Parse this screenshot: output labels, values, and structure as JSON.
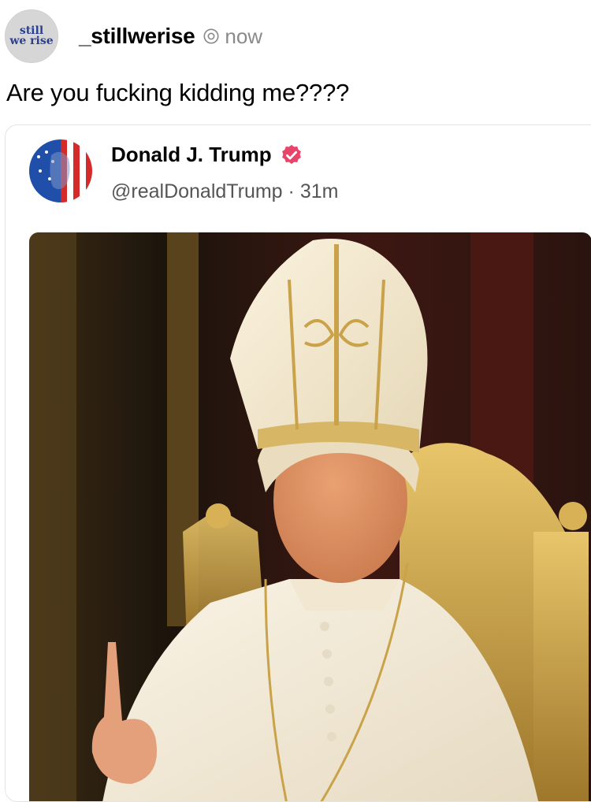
{
  "post": {
    "avatar_logo_line1": "still",
    "avatar_logo_line2": "we rise",
    "username": "_stillwerise",
    "timestamp": "now",
    "caption": "Are you fucking kidding me????"
  },
  "quoted_post": {
    "display_name": "Donald J. Trump",
    "handle": "@realDonaldTrump",
    "separator": "·",
    "age": "31m"
  },
  "colors": {
    "verified_badge": "#e8456b",
    "card_border": "#e4e4e4",
    "muted_text": "#8a8a8a"
  },
  "icons": {
    "threads": "threads-icon",
    "verified": "verified-badge-icon"
  }
}
